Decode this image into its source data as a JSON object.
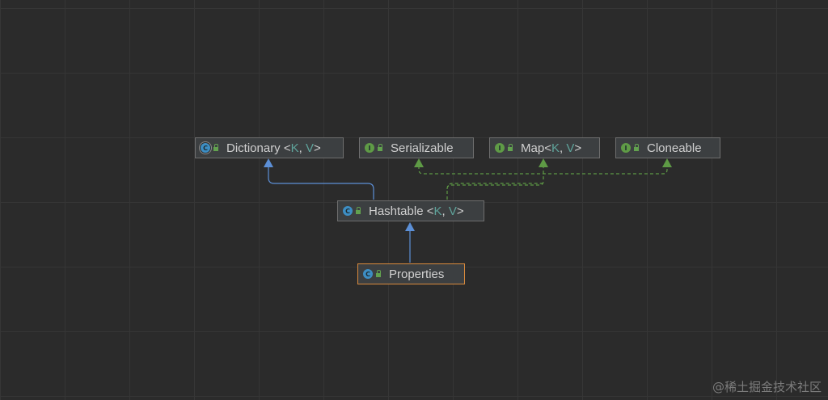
{
  "diagram": {
    "nodes": {
      "dictionary": {
        "name": "Dictionary",
        "open": "<",
        "p1": "K",
        "sep": ", ",
        "p2": "V",
        "close": ">",
        "icon": "C"
      },
      "serializable": {
        "name": "Serializable",
        "icon": "I"
      },
      "map": {
        "name": "Map",
        "open": "<",
        "p1": "K",
        "sep": ", ",
        "p2": "V",
        "close": ">",
        "icon": "I"
      },
      "cloneable": {
        "name": "Cloneable",
        "icon": "I"
      },
      "hashtable": {
        "name": "Hashtable",
        "open": "<",
        "p1": "K",
        "sep": ", ",
        "p2": "V",
        "close": ">",
        "icon": "C"
      },
      "properties": {
        "name": "Properties",
        "icon": "C"
      }
    },
    "edges": [
      {
        "from": "Hashtable",
        "to": "Dictionary",
        "kind": "extends"
      },
      {
        "from": "Hashtable",
        "to": "Serializable",
        "kind": "implements"
      },
      {
        "from": "Hashtable",
        "to": "Map",
        "kind": "implements"
      },
      {
        "from": "Hashtable",
        "to": "Cloneable",
        "kind": "implements"
      },
      {
        "from": "Properties",
        "to": "Hashtable",
        "kind": "extends"
      }
    ],
    "colors": {
      "background": "#2b2b2b",
      "extends_edge": "#5c8fd6",
      "implements_edge": "#5e9a45",
      "type_param": "#5fa39b",
      "selected_border": "#d98a3d"
    }
  },
  "watermark": "@稀土掘金技术社区"
}
